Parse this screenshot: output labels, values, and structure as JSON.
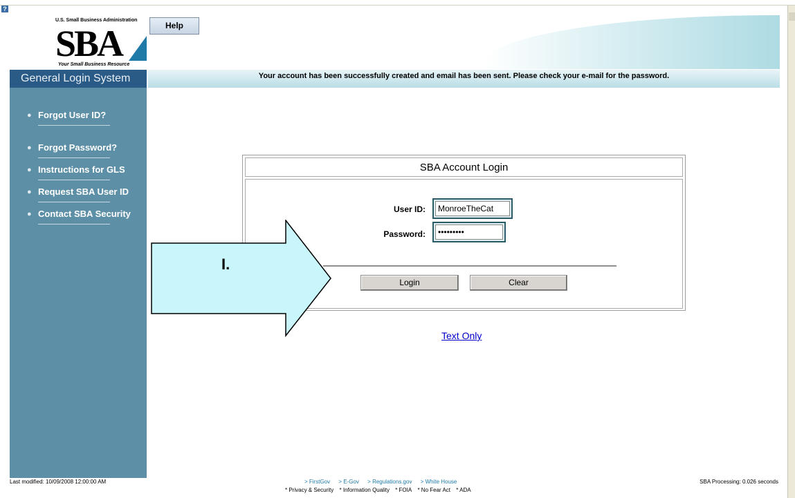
{
  "header": {
    "logo_top": "U.S. Small Business Administration",
    "logo_main": "SBA",
    "logo_tagline": "Your Small Business Resource",
    "help_label": "Help",
    "title": "General Login System",
    "message": "Your account has been successfully created and email has been sent. Please check your e-mail for the password."
  },
  "sidebar": {
    "items": [
      {
        "label": "Forgot User ID?"
      },
      {
        "label": "Forgot Password?"
      },
      {
        "label": "Instructions for GLS"
      },
      {
        "label": "Request SBA User ID"
      },
      {
        "label": "Contact SBA Security"
      }
    ]
  },
  "login": {
    "title": "SBA Account Login",
    "userid_label": "User ID:",
    "userid_value": "MonroeTheCat",
    "password_label": "Password:",
    "password_value": "MonroeCat",
    "login_label": "Login",
    "clear_label": "Clear"
  },
  "text_only": "Text Only",
  "annotation": {
    "label": "I."
  },
  "footer": {
    "last_modified": "Last modified: 10/09/2008 12:00:00 AM",
    "links": [
      "> FirstGov",
      "> E-Gov",
      "> Regulations.gov",
      "> White House"
    ],
    "policy": [
      "* Privacy & Security",
      "* Information Quality",
      "* FOIA",
      "* No Fear Act",
      "* ADA"
    ],
    "processing": "SBA Processing:  0.026 seconds"
  },
  "colors": {
    "sidebar": "#5d8fa6",
    "title_bar": "#2a5a86",
    "arrow_fill": "#c8f6fb",
    "link": "#0000cc"
  }
}
